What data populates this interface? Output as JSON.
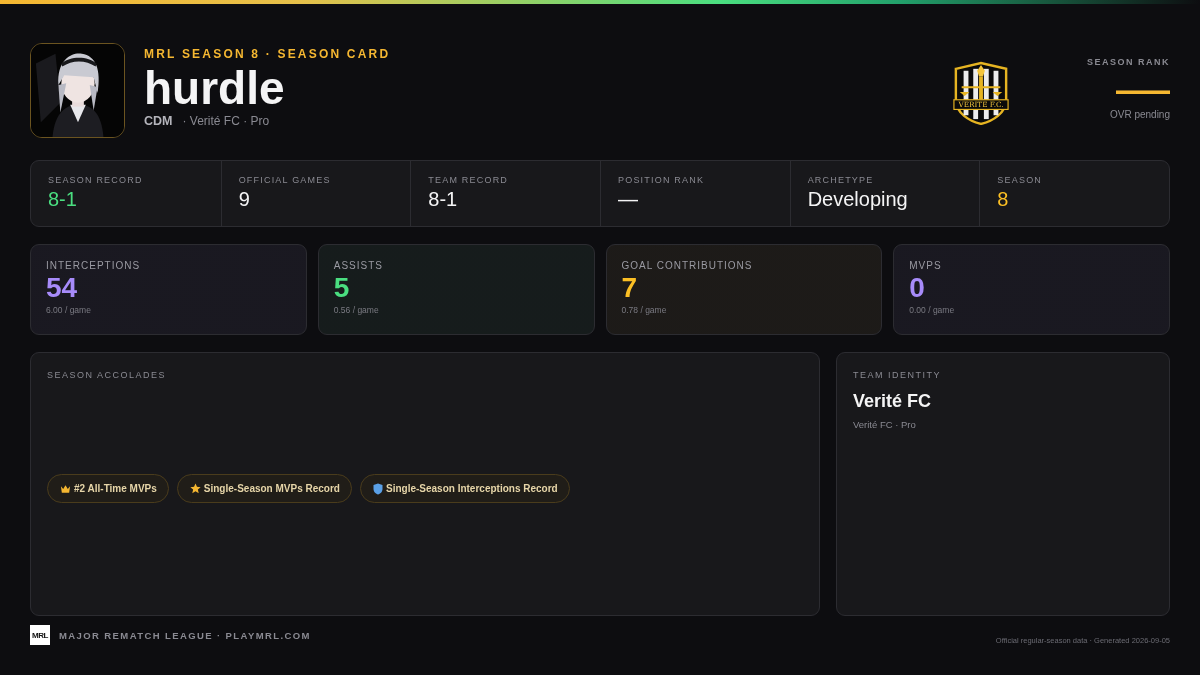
{
  "header": {
    "eyebrow": "MRL SEASON 8 · SEASON CARD",
    "player_name": "hurdle",
    "position": "CDM",
    "team_line": "· Verité FC · Pro",
    "crest_text": "VERITE F.C."
  },
  "season_rank": {
    "label": "SEASON RANK",
    "value": "—",
    "note": "OVR pending"
  },
  "summary": [
    {
      "label": "SEASON RECORD",
      "value": "8-1",
      "color": "#4ade80"
    },
    {
      "label": "OFFICIAL GAMES",
      "value": "9",
      "color": "#f4f4f5"
    },
    {
      "label": "TEAM RECORD",
      "value": "8-1",
      "color": "#f4f4f5"
    },
    {
      "label": "POSITION RANK",
      "value": "—",
      "color": "#f4f4f5"
    },
    {
      "label": "ARCHETYPE",
      "value": "Developing",
      "color": "#f4f4f5"
    },
    {
      "label": "SEASON",
      "value": "8",
      "color": "#fbbf24"
    }
  ],
  "stats": [
    {
      "label": "INTERCEPTIONS",
      "value": "54",
      "per_game": "6.00 / game",
      "color": "#a78bfa"
    },
    {
      "label": "ASSISTS",
      "value": "5",
      "per_game": "0.56 / game",
      "color": "#4ade80"
    },
    {
      "label": "GOAL CONTRIBUTIONS",
      "value": "7",
      "per_game": "0.78 / game",
      "color": "#fbbf24"
    },
    {
      "label": "MVPS",
      "value": "0",
      "per_game": "0.00 / game",
      "color": "#a78bfa"
    }
  ],
  "accolades": {
    "title": "SEASON ACCOLADES",
    "badges": [
      {
        "kind": "crown",
        "label": "#2 All-Time MVPs"
      },
      {
        "kind": "star",
        "label": "Single-Season MVPs Record"
      },
      {
        "kind": "shield",
        "label": "Single-Season Interceptions Record"
      }
    ]
  },
  "team_identity": {
    "title": "TEAM IDENTITY",
    "name": "Verité FC",
    "subtitle": "Verité FC · Pro"
  },
  "footer": {
    "logo_text": "MRL",
    "brand": "MAJOR REMATCH LEAGUE · PLAYMRL.COM",
    "note": "Official regular-season data · Generated 2026-09-05"
  }
}
